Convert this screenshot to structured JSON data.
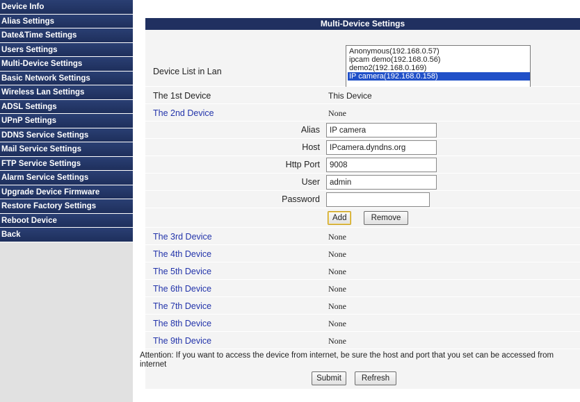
{
  "sidebar": {
    "items": [
      {
        "label": "Device Info"
      },
      {
        "label": "Alias Settings"
      },
      {
        "label": "Date&Time Settings"
      },
      {
        "label": "Users Settings"
      },
      {
        "label": "Multi-Device Settings"
      },
      {
        "label": "Basic Network Settings"
      },
      {
        "label": "Wireless Lan Settings"
      },
      {
        "label": "ADSL Settings"
      },
      {
        "label": "UPnP Settings"
      },
      {
        "label": "DDNS Service Settings"
      },
      {
        "label": "Mail Service Settings"
      },
      {
        "label": "FTP Service Settings"
      },
      {
        "label": "Alarm Service Settings"
      },
      {
        "label": "Upgrade Device Firmware"
      },
      {
        "label": "Restore Factory Settings"
      },
      {
        "label": "Reboot Device"
      },
      {
        "label": "Back"
      }
    ]
  },
  "main": {
    "title": "Multi-Device Settings",
    "device_list": {
      "label": "Device List in Lan",
      "options": [
        "Anonymous(192.168.0.57)",
        "ipcam demo(192.168.0.56)",
        "demo2(192.168.0.169)",
        "IP camera(192.168.0.158)"
      ],
      "selected": "IP camera(192.168.0.158)"
    },
    "first_device": {
      "label": "The 1st Device",
      "value": "This Device"
    },
    "second_device": {
      "label": "The 2nd Device",
      "value": "None"
    },
    "form": {
      "alias_label": "Alias",
      "alias_value": "IP camera",
      "host_label": "Host",
      "host_value": "IPcamera.dyndns.org",
      "port_label": "Http Port",
      "port_value": "9008",
      "user_label": "User",
      "user_value": "admin",
      "password_label": "Password",
      "password_value": ""
    },
    "add_label": "Add",
    "remove_label": "Remove",
    "other_devices": [
      {
        "label": "The 3rd Device",
        "value": "None"
      },
      {
        "label": "The 4th Device",
        "value": "None"
      },
      {
        "label": "The 5th Device",
        "value": "None"
      },
      {
        "label": "The 6th Device",
        "value": "None"
      },
      {
        "label": "The 7th Device",
        "value": "None"
      },
      {
        "label": "The 8th Device",
        "value": "None"
      },
      {
        "label": "The 9th Device",
        "value": "None"
      }
    ],
    "attention": "Attention: If you want to access the device from internet, be sure the host and port that you set can be accessed from internet",
    "submit_label": "Submit",
    "refresh_label": "Refresh"
  },
  "colors": {
    "nav_bg": "#1e2f5c",
    "title_bg": "#203060",
    "link_blue": "#2233aa",
    "selection_blue": "#2050c8"
  }
}
